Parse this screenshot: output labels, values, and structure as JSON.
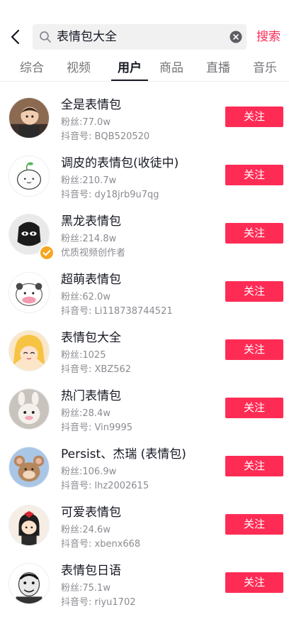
{
  "search": {
    "query": "表情包大全",
    "submit_label": "搜索",
    "back_icon": "chevron-left-icon",
    "search_icon": "magnifier-icon",
    "clear_icon": "clear-circle-icon"
  },
  "tabs": [
    {
      "label": "综合",
      "active": false
    },
    {
      "label": "视频",
      "active": false
    },
    {
      "label": "用户",
      "active": true
    },
    {
      "label": "商品",
      "active": false
    },
    {
      "label": "直播",
      "active": false
    },
    {
      "label": "音乐",
      "active": false
    }
  ],
  "users": [
    {
      "name": "全是表情包",
      "fans": "粉丝:77.0w",
      "sub": "抖音号: BQB520520",
      "follow": "关注"
    },
    {
      "name": "调皮的表情包(收徒中)",
      "fans": "粉丝:210.7w",
      "sub": "抖音号: dy18jrb9u7qg",
      "follow": "关注"
    },
    {
      "name": "黑龙表情包",
      "fans": "粉丝:214.8w",
      "sub": "优质视频创作者",
      "follow": "关注",
      "verified": true
    },
    {
      "name": "超萌表情包",
      "fans": "粉丝:62.0w",
      "sub": "抖音号: Li118738744521",
      "follow": "关注"
    },
    {
      "name": "表情包大全",
      "fans": "粉丝:1025",
      "sub": "抖音号: XBZ562",
      "follow": "关注"
    },
    {
      "name": "热门表情包",
      "fans": "粉丝:28.4w",
      "sub": "抖音号: Vin9995",
      "follow": "关注"
    },
    {
      "name": "Persist、杰瑞 (表情包)",
      "fans": "粉丝:106.9w",
      "sub": "抖音号: lhz2002615",
      "follow": "关注"
    },
    {
      "name": "可爱表情包",
      "fans": "粉丝:24.6w",
      "sub": "抖音号: xbenx668",
      "follow": "关注"
    },
    {
      "name": "表情包日语",
      "fans": "粉丝:75.1w",
      "sub": "抖音号: riyu1702",
      "follow": "关注"
    }
  ],
  "colors": {
    "accent": "#fe2c55",
    "text": "#161823",
    "secondary": "#8a8b91",
    "verified": "#f5a623"
  }
}
